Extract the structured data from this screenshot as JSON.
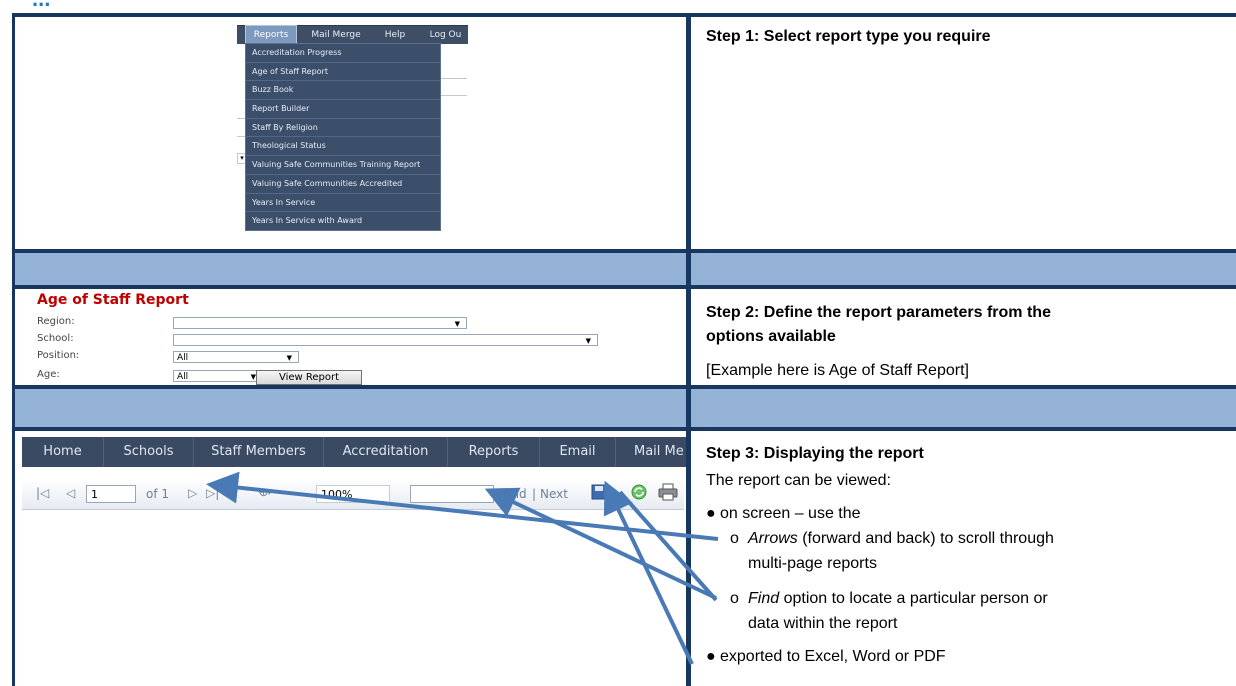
{
  "header": {
    "title": "..."
  },
  "row1": {
    "menu_bar": [
      "Reports",
      "Mail Merge",
      "Help",
      "Log Ou"
    ],
    "dropdown_items": [
      "Accreditation Progress",
      "Age of Staff Report",
      "Buzz Book",
      "Report Builder",
      "Staff By Religion",
      "Theological Status",
      "Valuing Safe Communities Training Report",
      "Valuing Safe Communities Accredited",
      "Years In Service",
      "Years In Service with Award"
    ],
    "step_title": "Step 1: Select report type you require"
  },
  "row2": {
    "form_title": "Age of Staff Report",
    "labels": {
      "region": "Region:",
      "school": "School:",
      "position": "Position:",
      "age": "Age:"
    },
    "values": {
      "region": "",
      "school": "",
      "position": "All",
      "age": "All"
    },
    "view_button": "View Report",
    "step_title_line1": "Step 2: Define the report parameters from the",
    "step_title_line2": "options available",
    "step_note": "[Example here is Age of Staff Report]"
  },
  "row3": {
    "nav_items": [
      "Home",
      "Schools",
      "Staff Members",
      "Accreditation",
      "Reports",
      "Email",
      "Mail Me"
    ],
    "toolbar": {
      "page_value": "1",
      "of_label": "of 1",
      "zoom": "100%",
      "find_value": "",
      "find_label": "Find",
      "separator": "|",
      "next_label": "Next"
    },
    "step_title": "Step 3: Displaying the report",
    "intro": "The report can be viewed:",
    "bullet1": "on screen – use the",
    "sub1_em": "Arrows",
    "sub1_rest_line1": " (forward and back) to scroll through",
    "sub1_rest_line2": "multi-page reports",
    "sub2_em": "Find",
    "sub2_rest_line1": " option to locate a particular person or",
    "sub2_rest_line2": "data within the report",
    "bullet2": "exported to Excel, Word or PDF"
  },
  "colors": {
    "frame": "#17375e",
    "band": "#95b3d7",
    "accent_red": "#c00000",
    "arrow": "#4a7ab5"
  }
}
